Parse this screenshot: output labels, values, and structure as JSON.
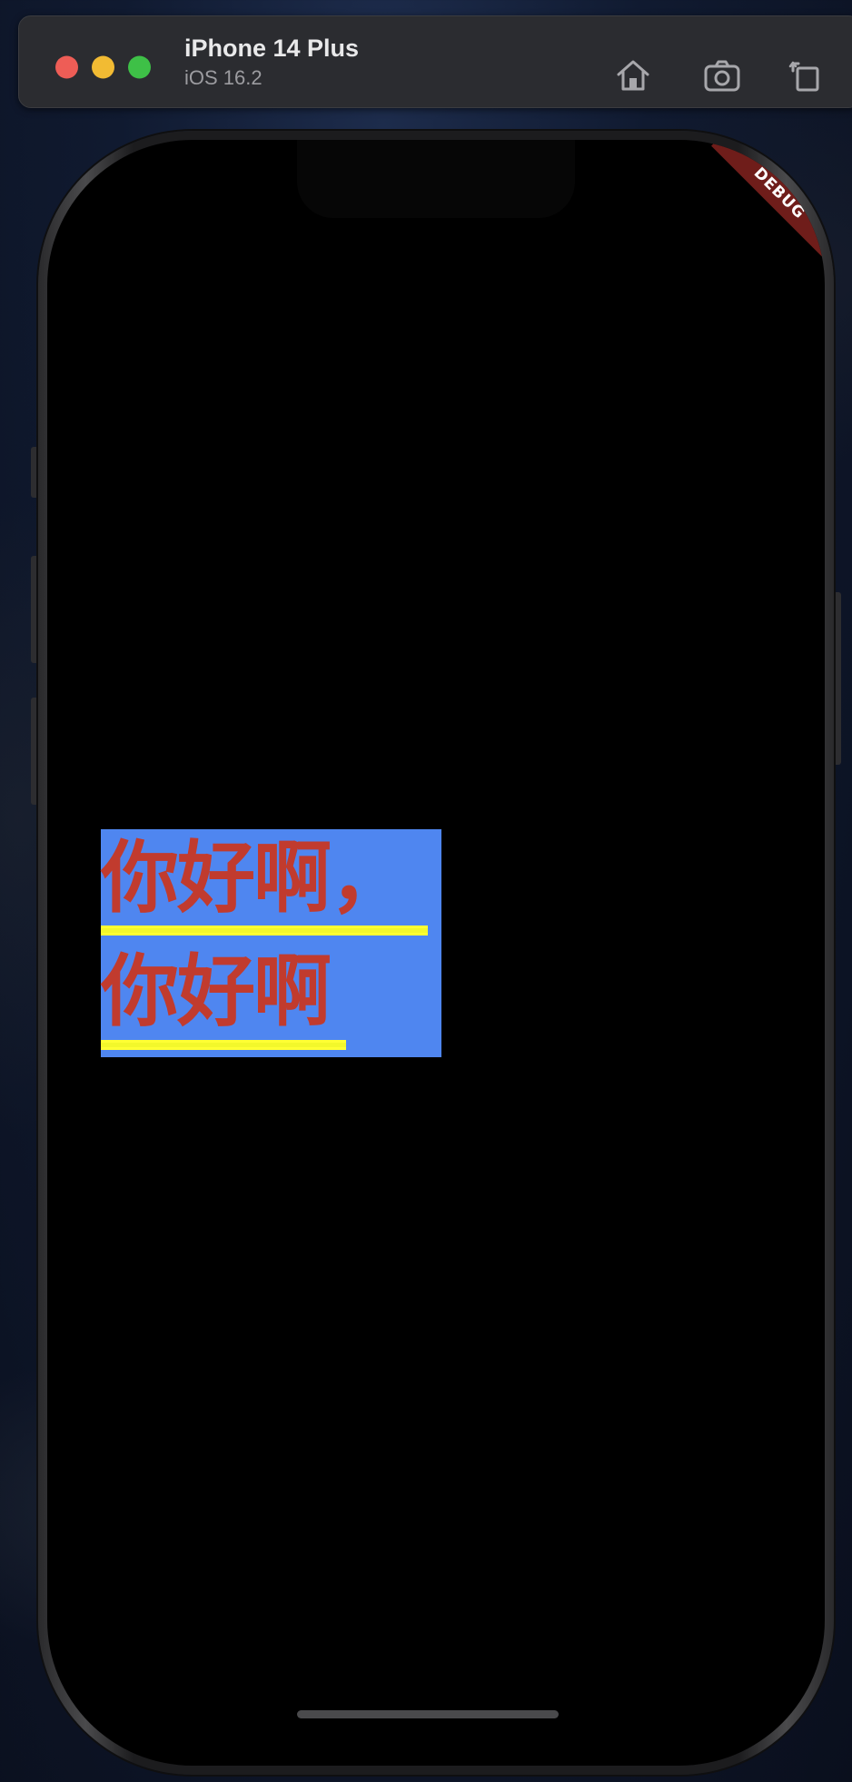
{
  "titlebar": {
    "device_name": "iPhone 14 Plus",
    "os_version": "iOS 16.2",
    "icons": [
      "home-icon",
      "screenshot-icon",
      "rotate-icon"
    ]
  },
  "screen": {
    "debug_banner": "DEBUG",
    "lines": [
      "你好啊，",
      "你好啊"
    ]
  },
  "colors": {
    "background_box": "#4f86f0",
    "text": "#c13b2e",
    "underline": "#f3f82b",
    "screen": "#000000"
  }
}
